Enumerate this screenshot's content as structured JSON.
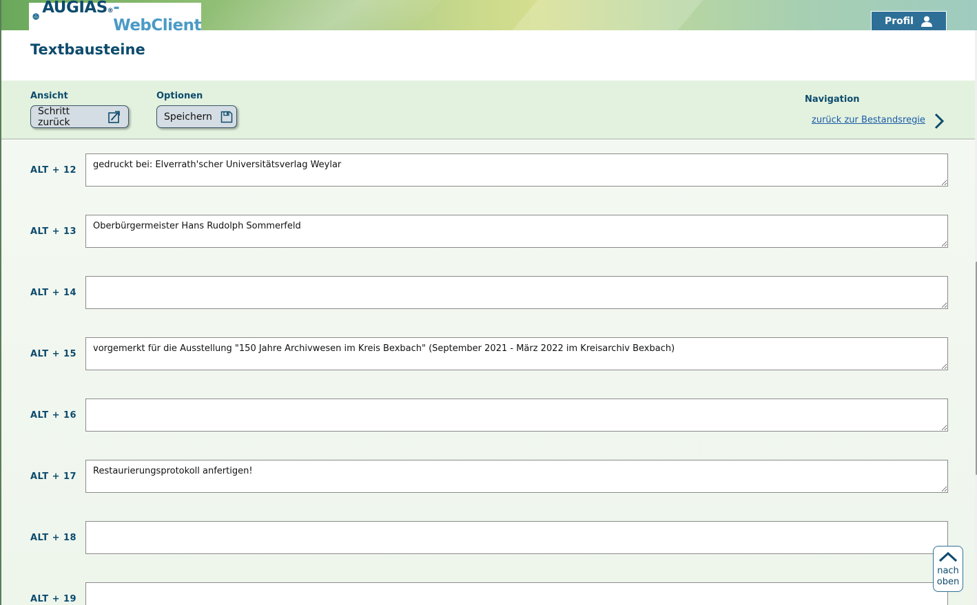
{
  "app": {
    "logo_brand": "AUGIAS",
    "logo_reg": "®",
    "logo_suffix": "-WebClient"
  },
  "header": {
    "profile_label": "Profil"
  },
  "page": {
    "title": "Textbausteine"
  },
  "toolbar": {
    "view_label": "Ansicht",
    "back_button": "Schritt zurück",
    "options_label": "Optionen",
    "save_button": "Speichern",
    "navigation_label": "Navigation",
    "navigation_link": "zurück zur Bestandsregie"
  },
  "rows": [
    {
      "label": "ALT + 12",
      "value": "gedruckt bei: Elverrath'scher Universitätsverlag Weylar"
    },
    {
      "label": "ALT + 13",
      "value": "Oberbürgermeister Hans Rudolph Sommerfeld"
    },
    {
      "label": "ALT + 14",
      "value": ""
    },
    {
      "label": "ALT + 15",
      "value": "vorgemerkt für die Ausstellung \"150 Jahre Archivwesen im Kreis Bexbach\" (September 2021 - März 2022 im Kreisarchiv Bexbach)"
    },
    {
      "label": "ALT + 16",
      "value": ""
    },
    {
      "label": "ALT + 17",
      "value": "Restaurierungsprotokoll anfertigen!"
    },
    {
      "label": "ALT + 18",
      "value": ""
    },
    {
      "label": "ALT + 19",
      "value": ""
    }
  ],
  "to_top": {
    "line1": "nach",
    "line2": "oben"
  },
  "colors": {
    "primary": "#0d4b6d",
    "accent": "#2e6f97",
    "toolbar_bg": "#e3f2df",
    "link": "#1a5aa6"
  },
  "icons": {
    "logo": "augias-logo-icon",
    "profile": "user-icon",
    "back": "edit-back-icon",
    "save": "floppy-disk-icon",
    "nav": "chevron-right-icon",
    "to_top": "chevron-up-icon"
  }
}
